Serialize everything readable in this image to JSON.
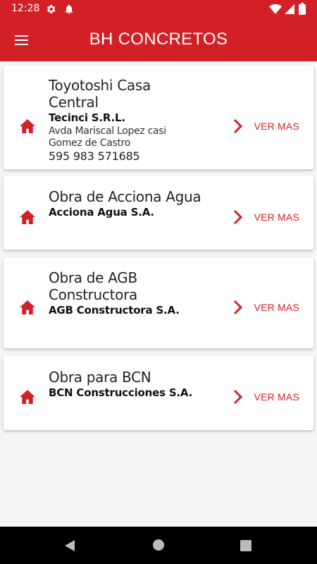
{
  "status_bar": {
    "time": "12:28"
  },
  "app_bar": {
    "title": "BH CONCRETOS"
  },
  "colors": {
    "primary": "#d32027",
    "surface": "#ffffff",
    "background": "#f5f5f5"
  },
  "icons": {
    "menu": "menu-icon",
    "card": "home-icon",
    "action": "chevron-right-icon"
  },
  "obras": [
    {
      "title": "Toyotoshi Casa Central",
      "company": "Tecinci S.R.L.",
      "address": "Avda Mariscal Lopez casi Gomez de Castro",
      "phone": "595 983 571685",
      "action_label": "VER MAS"
    },
    {
      "title": "Obra de Acciona Agua",
      "company": "Acciona Agua S.A.",
      "action_label": "VER MAS"
    },
    {
      "title": "Obra de AGB Constructora",
      "company": "AGB Constructora S.A.",
      "action_label": "VER MAS"
    },
    {
      "title": "Obra para BCN",
      "company": "BCN Construcciones S.A.",
      "action_label": "VER MAS"
    }
  ]
}
